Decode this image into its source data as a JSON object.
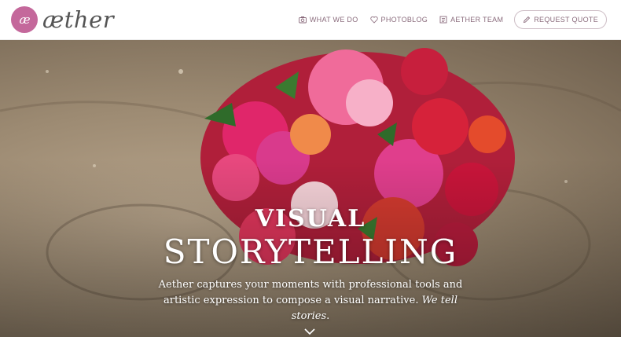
{
  "brand": {
    "mark": "æ",
    "name": "æther",
    "accent": "#c4689b"
  },
  "nav": {
    "items": [
      {
        "label": "WHAT WE DO",
        "icon": "camera-icon"
      },
      {
        "label": "PHOTOBLOG",
        "icon": "heart-icon"
      },
      {
        "label": "AETHER TEAM",
        "icon": "book-icon"
      }
    ],
    "cta": {
      "label": "REQUEST QUOTE",
      "icon": "pencil-icon"
    }
  },
  "hero": {
    "title_line1": "VISUAL",
    "title_line2": "STORYTELLING",
    "desc_main": "Aether captures your moments with professional tools and artistic expression to compose a visual narrative.",
    "desc_emph": "We tell stories",
    "desc_end": ".",
    "scroll_icon": "chevron-down-icon"
  }
}
